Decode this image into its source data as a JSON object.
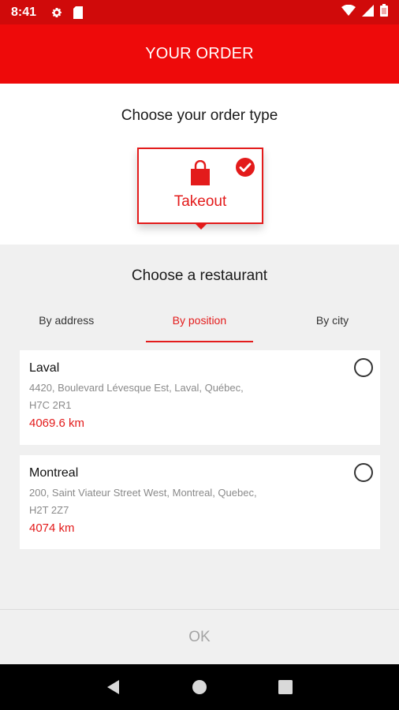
{
  "status_bar": {
    "time": "8:41",
    "icons": [
      "settings-icon",
      "sd-card-icon",
      "wifi-icon",
      "signal-icon",
      "battery-icon"
    ]
  },
  "header": {
    "title": "YOUR ORDER"
  },
  "order_type": {
    "title": "Choose your order type",
    "options": [
      {
        "label": "Takeout",
        "icon": "shopping-bag-icon",
        "selected": true
      }
    ]
  },
  "restaurant": {
    "title": "Choose a restaurant",
    "tabs": [
      {
        "label": "By address",
        "active": false
      },
      {
        "label": "By position",
        "active": true
      },
      {
        "label": "By city",
        "active": false
      }
    ],
    "items": [
      {
        "name": "Laval",
        "address": "4420, Boulevard Lévesque Est, Laval, Québec, H7C 2R1",
        "distance": "4069.6 km",
        "selected": false
      },
      {
        "name": "Montreal",
        "address": "200, Saint Viateur Street West, Montreal, Quebec, H2T 2Z7",
        "distance": "4074 km",
        "selected": false
      }
    ]
  },
  "footer": {
    "ok_label": "OK"
  },
  "nav_bar": {
    "buttons": [
      "back-icon",
      "home-icon",
      "recents-icon"
    ]
  },
  "colors": {
    "brand_red": "#ee0a0a",
    "status_red": "#d00a0a",
    "accent_red": "#e31b1b",
    "background_gray": "#f0f0f0",
    "disabled_text": "#a4a4a4"
  }
}
